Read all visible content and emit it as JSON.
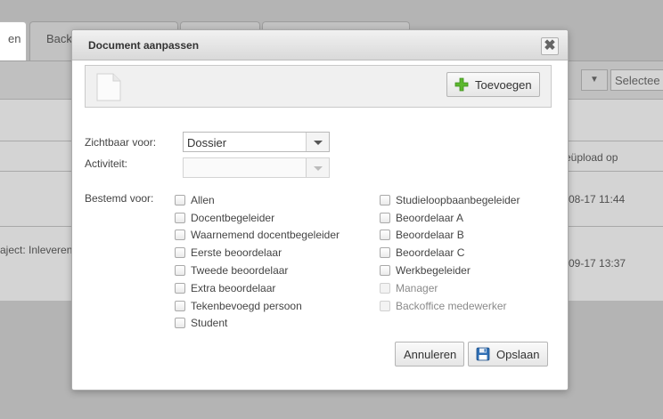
{
  "background": {
    "tabs": [
      "en",
      "Backo"
    ],
    "select_placeholder": "Selectee",
    "table_header_upload": "eüpload op",
    "rows": [
      {
        "project": "",
        "date": "-08-17 11:44"
      },
      {
        "project": "aject: Inleveren",
        "date": "-09-17 13:37"
      }
    ]
  },
  "dialog": {
    "title": "Document aanpassen",
    "close_symbol": "✖",
    "add_button": "Toevoegen",
    "visible_for_label": "Zichtbaar voor:",
    "visible_for_value": "Dossier",
    "activity_label": "Activiteit:",
    "activity_value": "",
    "intended_for_label": "Bestemd voor:",
    "checkboxes_left": [
      {
        "label": "Allen",
        "enabled": true
      },
      {
        "label": "Docentbegeleider",
        "enabled": true
      },
      {
        "label": "Waarnemend docentbegeleider",
        "enabled": true
      },
      {
        "label": "Eerste beoordelaar",
        "enabled": true
      },
      {
        "label": "Tweede beoordelaar",
        "enabled": true
      },
      {
        "label": "Extra beoordelaar",
        "enabled": true
      },
      {
        "label": "Tekenbevoegd persoon",
        "enabled": true
      },
      {
        "label": "Student",
        "enabled": true
      }
    ],
    "checkboxes_right": [
      {
        "label": "Studieloopbaanbegeleider",
        "enabled": true
      },
      {
        "label": "Beoordelaar A",
        "enabled": true
      },
      {
        "label": "Beoordelaar B",
        "enabled": true
      },
      {
        "label": "Beoordelaar C",
        "enabled": true
      },
      {
        "label": "Werkbegeleider",
        "enabled": true
      },
      {
        "label": "Manager",
        "enabled": false
      },
      {
        "label": "Backoffice medewerker",
        "enabled": false
      }
    ],
    "cancel_button": "Annuleren",
    "save_button": "Opslaan"
  },
  "colors": {
    "add_icon": "#5cb82e",
    "save_icon": "#2f6fb5"
  }
}
